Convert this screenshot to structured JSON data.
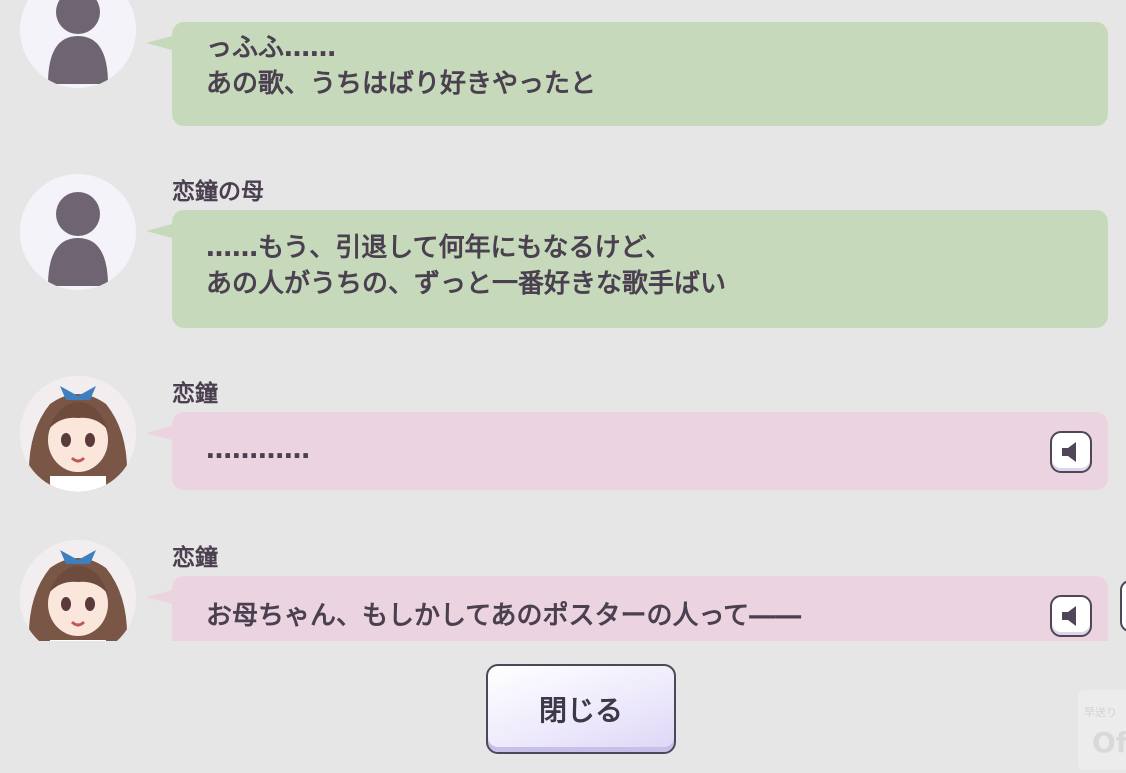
{
  "log": {
    "entries": [
      {
        "speaker": "",
        "lines": [
          "っふふ……",
          "あの歌、うちはばり好きやったと"
        ],
        "avatar": "silhouette-icon",
        "bubble_color": "#c6dabb",
        "has_voice": false
      },
      {
        "speaker": "恋鐘の母",
        "lines": [
          "……もう、引退して何年にもなるけど、",
          "あの人がうちの、ずっと一番好きな歌手ばい"
        ],
        "avatar": "silhouette-icon",
        "bubble_color": "#c6dabb",
        "has_voice": false
      },
      {
        "speaker": "恋鐘",
        "lines": [
          "…………"
        ],
        "avatar": "character-portrait-icon",
        "bubble_color": "#ebd4e0",
        "has_voice": true
      },
      {
        "speaker": "恋鐘",
        "lines": [
          "お母ちゃん、もしかしてあのポスターの人って――"
        ],
        "avatar": "character-portrait-icon",
        "bubble_color": "#ebd4e0",
        "has_voice": true
      }
    ]
  },
  "close_label": "閉じる",
  "watermark": {
    "small": "早送り",
    "big": "Of"
  },
  "icons": {
    "voice": "speaker-icon",
    "close": "close-button"
  },
  "colors": {
    "background": "#e6e6e6",
    "green_bubble": "#c6dabb",
    "pink_bubble": "#ebd4e0",
    "text": "#4a4050"
  }
}
